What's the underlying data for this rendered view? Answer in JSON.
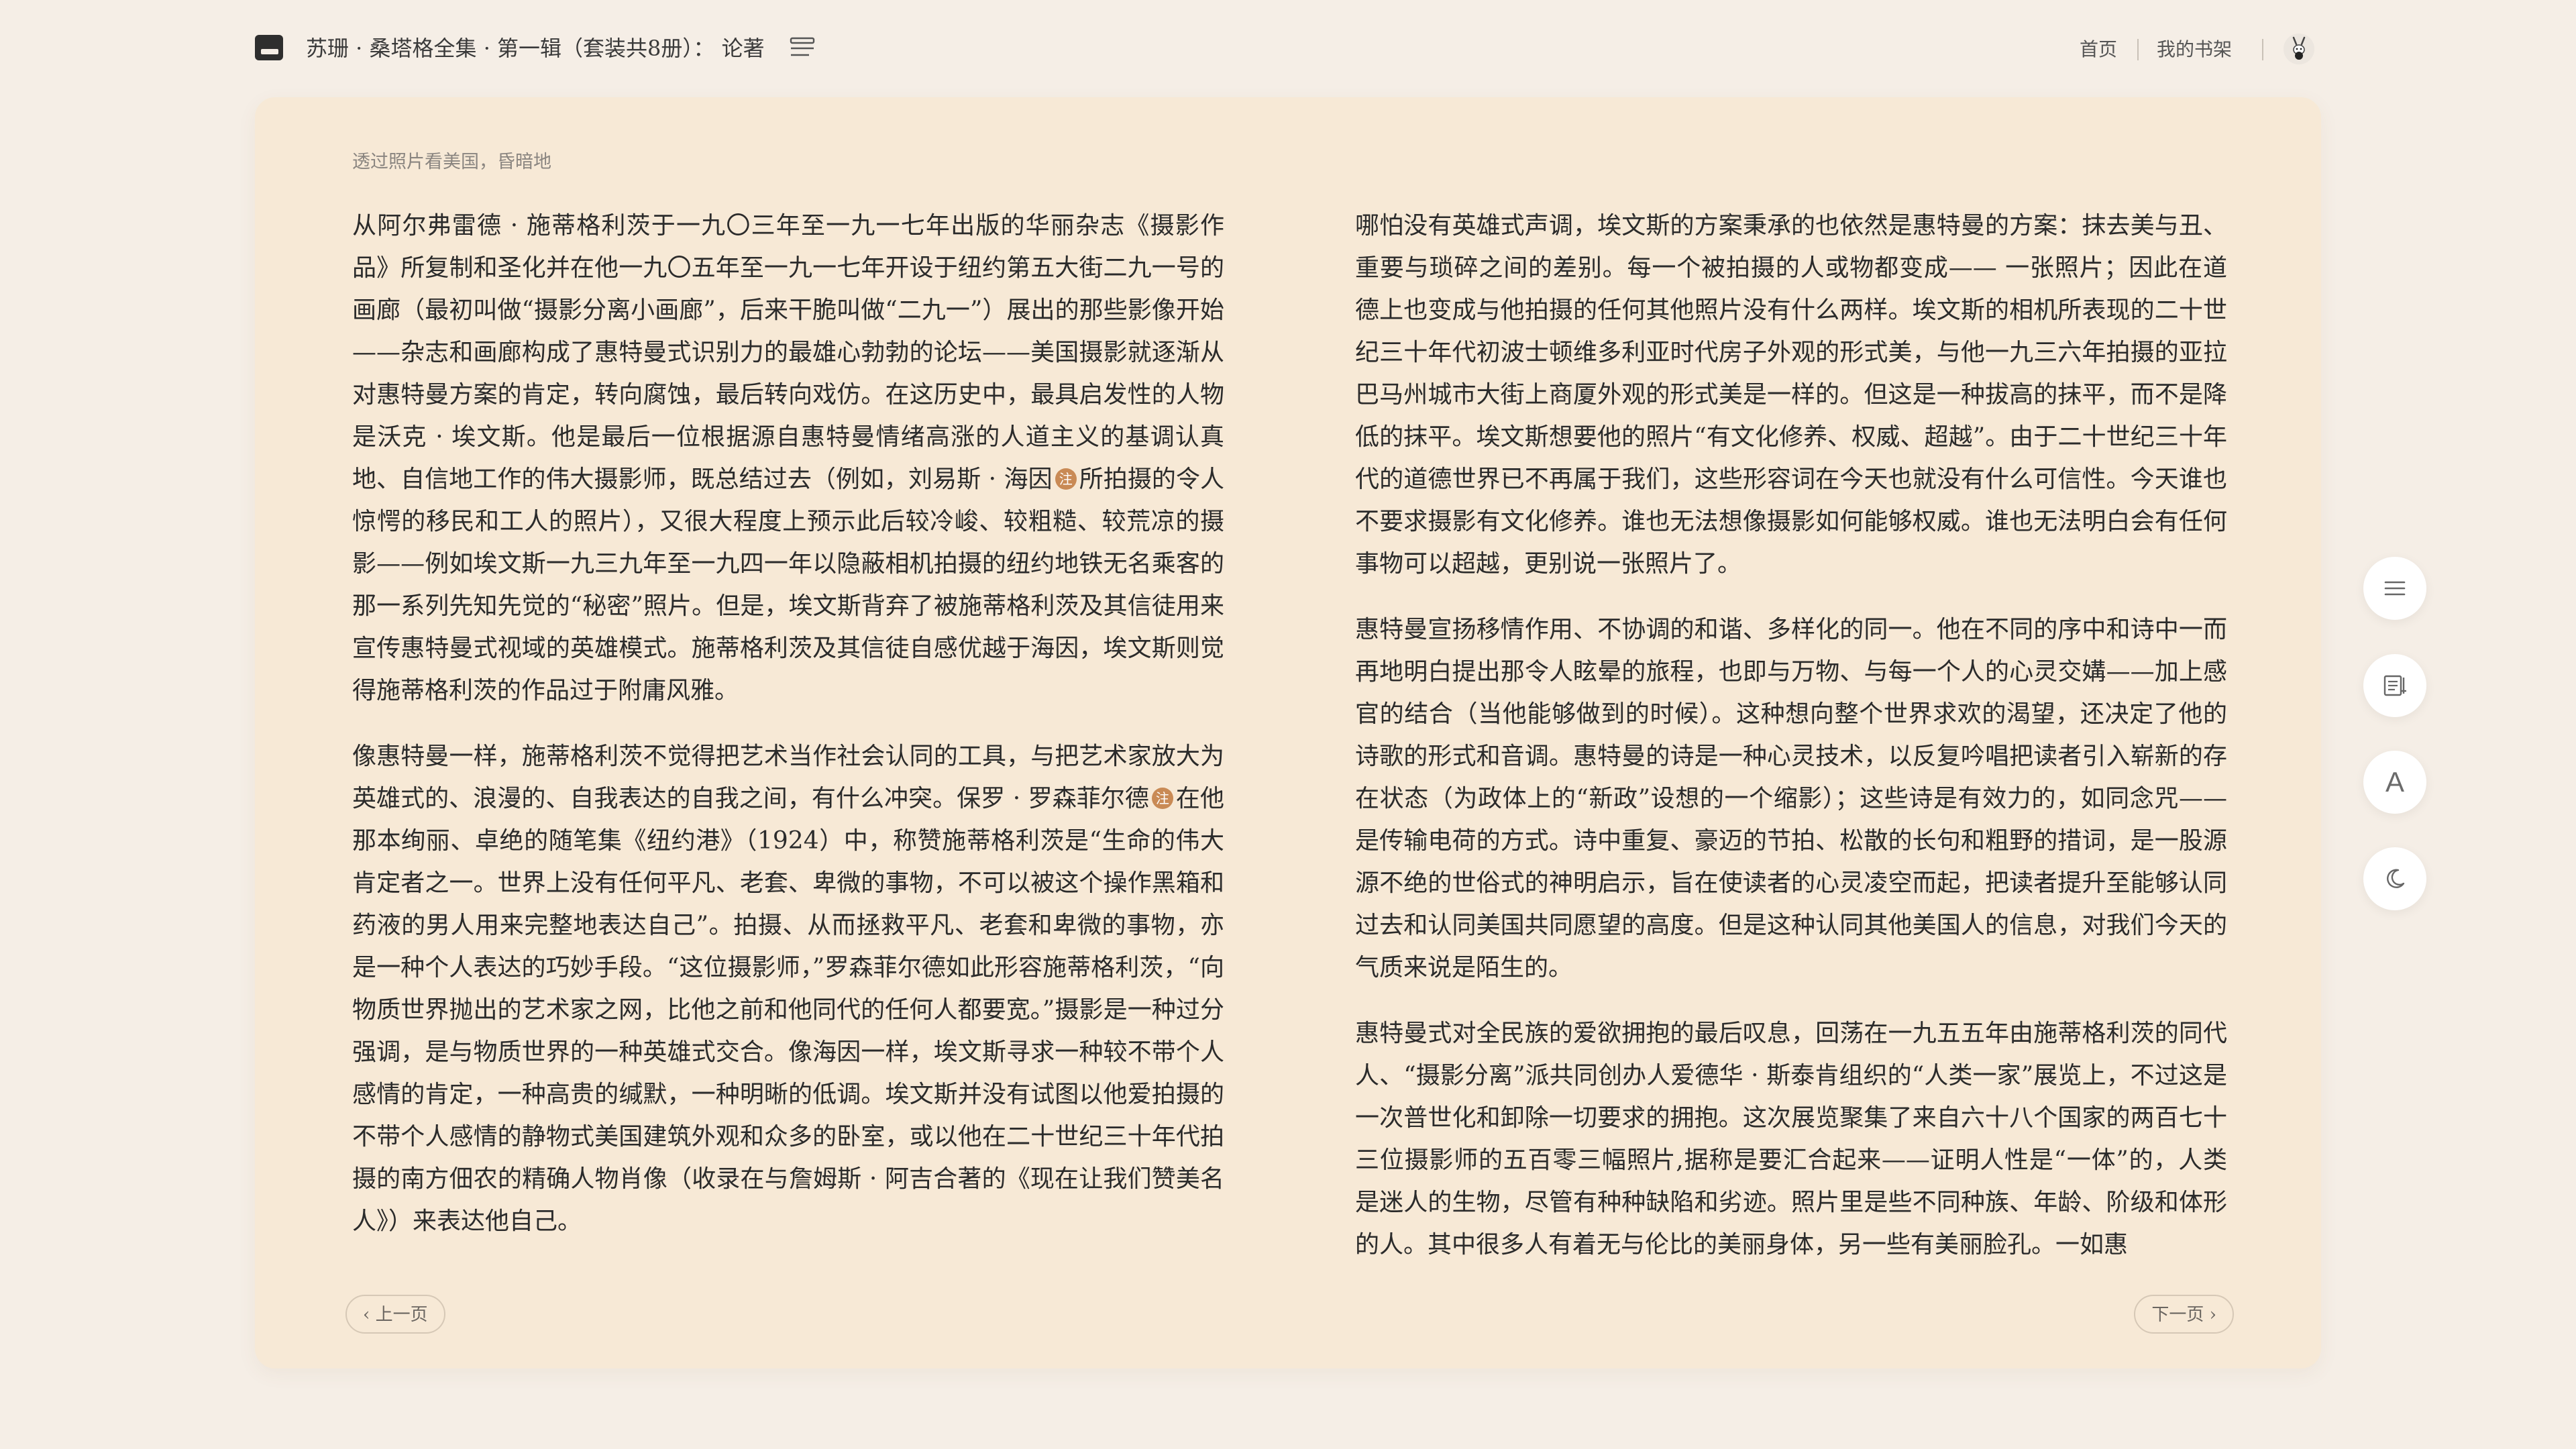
{
  "header": {
    "book_title": "苏珊 · 桑塔格全集 · 第一辑（套装共8册）： 论著",
    "nav": {
      "home": "首页",
      "bookshelf": "我的书架"
    }
  },
  "reader": {
    "chapter_title": "透过照片看美国，昏暗地",
    "note_mark": "注",
    "left_column": {
      "p1_before_note": "从阿尔弗雷德 · 施蒂格利茨于一九〇三年至一九一七年出版的华丽杂志《摄影作品》所复制和圣化并在他一九〇五年至一九一七年开设于纽约第五大街二九一号的画廊（最初叫做“摄影分离小画廊”，后来干脆叫做“二九一”）展出的那些影像开始——杂志和画廊构成了惠特曼式识别力的最雄心勃勃的论坛——美国摄影就逐渐从对惠特曼方案的肯定，转向腐蚀，最后转向戏仿。在这历史中，最具启发性的人物是沃克 · 埃文斯。他是最后一位根据源自惠特曼情绪高涨的人道主义的基调认真地、自信地工作的伟大摄影师，既总结过去（例如，刘易斯 · 海因",
      "p1_after_note": "所拍摄的令人惊愕的移民和工人的照片），又很大程度上预示此后较冷峻、较粗糙、较荒凉的摄影——例如埃文斯一九三九年至一九四一年以隐蔽相机拍摄的纽约地铁无名乘客的那一系列先知先觉的“秘密”照片。但是，埃文斯背弃了被施蒂格利茨及其信徒用来宣传惠特曼式视域的英雄模式。施蒂格利茨及其信徒自感优越于海因，埃文斯则觉得施蒂格利茨的作品过于附庸风雅。",
      "p2_before_note": "像惠特曼一样，施蒂格利茨不觉得把艺术当作社会认同的工具，与把艺术家放大为英雄式的、浪漫的、自我表达的自我之间，有什么冲突。保罗 · 罗森菲尔德",
      "p2_after_note": "在他那本绚丽、卓绝的随笔集《纽约港》（1924）中，称赞施蒂格利茨是“生命的伟大肯定者之一。世界上没有任何平凡、老套、卑微的事物，不可以被这个操作黑箱和药液的男人用来完整地表达自己”。拍摄、从而拯救平凡、老套和卑微的事物，亦是一种个人表达的巧妙手段。“这位摄影师，”罗森菲尔德如此形容施蒂格利茨，“向物质世界抛出的艺术家之网，比他之前和他同代的任何人都要宽。”摄影是一种过分强调，是与物质世界的一种英雄式交合。像海因一样，埃文斯寻求一种较不带个人感情的肯定，一种高贵的缄默，一种明晰的低调。埃文斯并没有试图以他爱拍摄的不带个人感情的静物式美国建筑外观和众多的卧室，或以他在二十世纪三十年代拍摄的南方佃农的精确人物肖像（收录在与詹姆斯 · 阿吉合著的《现在让我们赞美名人》）来表达他自己。"
    },
    "right_column": {
      "p1": "哪怕没有英雄式声调，埃文斯的方案秉承的也依然是惠特曼的方案：抹去美与丑、重要与琐碎之间的差别。每一个被拍摄的人或物都变成—— 一张照片；因此在道德上也变成与他拍摄的任何其他照片没有什么两样。埃文斯的相机所表现的二十世纪三十年代初波士顿维多利亚时代房子外观的形式美，与他一九三六年拍摄的亚拉巴马州城市大街上商厦外观的形式美是一样的。但这是一种拔高的抹平，而不是降低的抹平。埃文斯想要他的照片“有文化修养、权威、超越”。由于二十世纪三十年代的道德世界已不再属于我们，这些形容词在今天也就没有什么可信性。今天谁也不要求摄影有文化修养。谁也无法想像摄影如何能够权威。谁也无法明白会有任何事物可以超越，更别说一张照片了。",
      "p2": "惠特曼宣扬移情作用、不协调的和谐、多样化的同一。他在不同的序中和诗中一而再地明白提出那令人眩晕的旅程，也即与万物、与每一个人的心灵交媾——加上感官的结合（当他能够做到的时候）。这种想向整个世界求欢的渴望，还决定了他的诗歌的形式和音调。惠特曼的诗是一种心灵技术，以反复吟唱把读者引入崭新的存在状态（为政体上的“新政”设想的一个缩影）；这些诗是有效力的，如同念咒——是传输电荷的方式。诗中重复、豪迈的节拍、松散的长句和粗野的措词，是一股源源不绝的世俗式的神明启示，旨在使读者的心灵凌空而起，把读者提升至能够认同过去和认同美国共同愿望的高度。但是这种认同其他美国人的信息，对我们今天的气质来说是陌生的。",
      "p3": "惠特曼式对全民族的爱欲拥抱的最后叹息，回荡在一九五五年由施蒂格利茨的同代人、“摄影分离”派共同创办人爱德华 · 斯泰肯组织的“人类一家”展览上，不过这是一次普世化和卸除一切要求的拥抱。这次展览聚集了来自六十八个国家的两百七十三位摄影师的五百零三幅照片,据称是要汇合起来——证明人性是“一体”的，人类是迷人的生物，尽管有种种缺陷和劣迹。照片里是些不同种族、年龄、阶级和体形的人。其中很多人有着无与伦比的美丽身体，另一些有美丽脸孔。一如惠"
    },
    "pager": {
      "prev": "上一页",
      "next": "下一页"
    }
  },
  "tools": {
    "font_label": "A"
  },
  "colors": {
    "background": "#f5eee6",
    "page": "#f7e9d6",
    "note_mark": "#c98a55"
  }
}
